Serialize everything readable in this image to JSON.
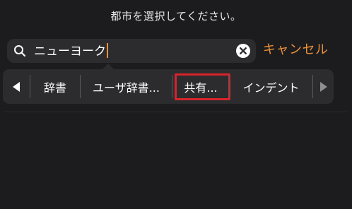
{
  "prompt": "都市を選択してください。",
  "search": {
    "value": "ニューヨーク",
    "icon": "search-icon",
    "clear_icon": "clear-icon"
  },
  "cancel_label": "キャンセル",
  "menu": {
    "prev_icon": "arrow-left-icon",
    "next_icon": "arrow-right-icon",
    "items": [
      {
        "label": "辞書"
      },
      {
        "label": "ユーザ辞書..."
      },
      {
        "label": "共有..."
      },
      {
        "label": "インデント"
      }
    ],
    "highlighted_item": "共有..."
  },
  "colors": {
    "background": "#1c1c1e",
    "field": "#2c2c2e",
    "accent": "#e8913a",
    "highlight": "#d8232a"
  }
}
